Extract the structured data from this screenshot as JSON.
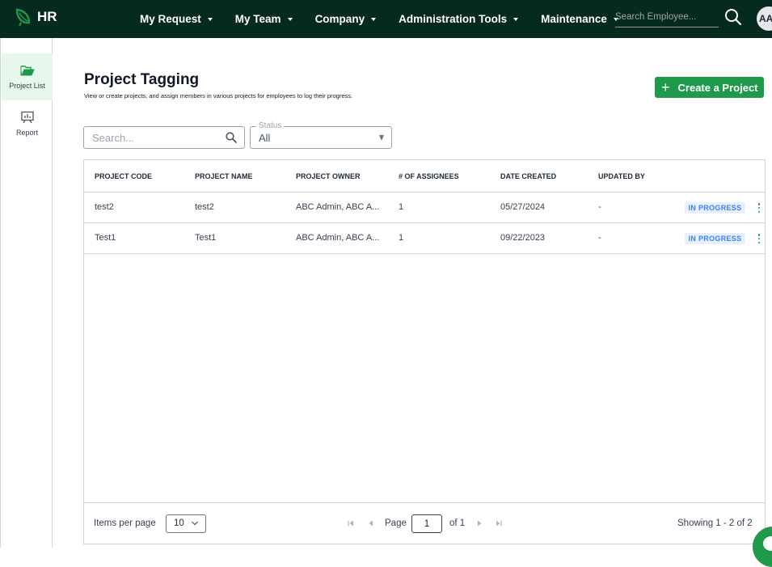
{
  "brand": {
    "name": "HR",
    "color": "#1f9a4a",
    "bar_color": "#062a1f"
  },
  "nav": [
    {
      "label": "My Request"
    },
    {
      "label": "My Team"
    },
    {
      "label": "Company"
    },
    {
      "label": "Administration Tools"
    },
    {
      "label": "Maintenance"
    }
  ],
  "header": {
    "search_placeholder": "Search Employee...",
    "avatar_initials": "AA"
  },
  "sidebar": {
    "items": [
      {
        "label": "Project List",
        "icon": "folder-open-icon",
        "active": true
      },
      {
        "label": "Report",
        "icon": "presentation-chart-icon",
        "active": false
      }
    ]
  },
  "page": {
    "title": "Project Tagging",
    "subtitle": "View or create projects, and assign members in various projects for employees to log their progress.",
    "create_button": "Create a Project"
  },
  "filters": {
    "search_placeholder": "Search...",
    "status_label": "Status",
    "status_value": "All"
  },
  "table": {
    "headers": [
      "PROJECT CODE",
      "PROJECT NAME",
      "PROJECT OWNER",
      "# OF ASSIGNEES",
      "DATE CREATED",
      "UPDATED BY"
    ],
    "rows": [
      {
        "code": "test2",
        "name": "test2",
        "owner": "ABC Admin, ABC A...",
        "assignees": "1",
        "date_created": "05/27/2024",
        "updated_by": "-",
        "status": "IN PROGRESS"
      },
      {
        "code": "Test1",
        "name": "Test1",
        "owner": "ABC Admin, ABC A...",
        "assignees": "1",
        "date_created": "09/22/2023",
        "updated_by": "-",
        "status": "IN PROGRESS"
      }
    ]
  },
  "pagination": {
    "items_per_page_label": "Items per page",
    "items_per_page_value": "10",
    "page_label": "Page",
    "page_value": "1",
    "of_label": "of 1",
    "showing": "Showing   1 - 2 of 2"
  }
}
